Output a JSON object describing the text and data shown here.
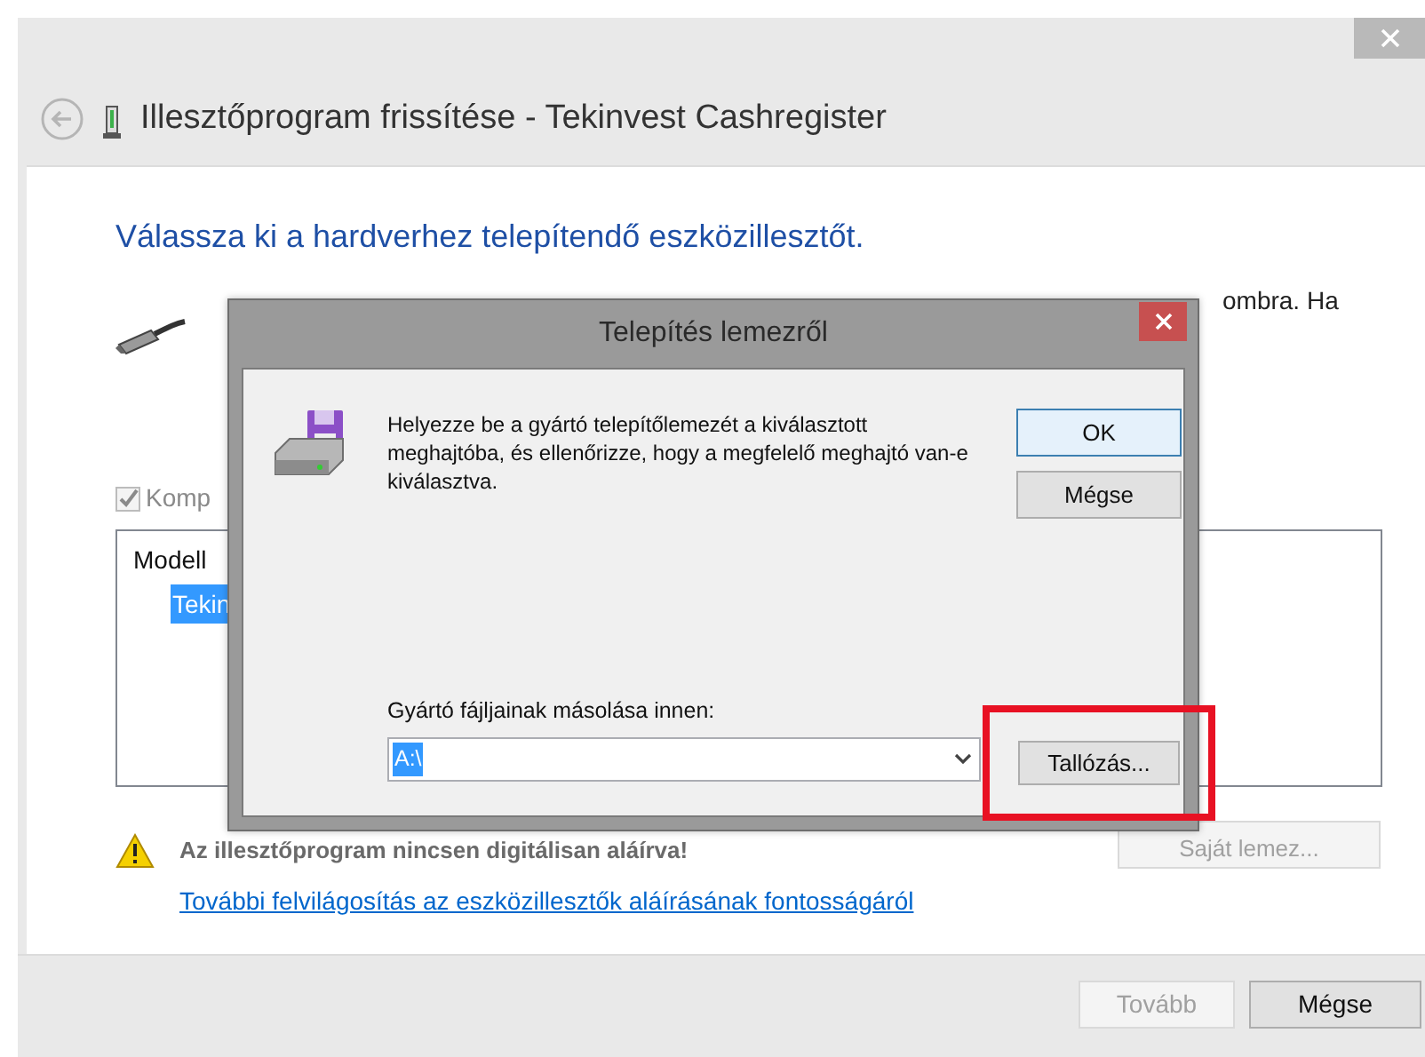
{
  "window": {
    "title": "Illesztőprogram frissítése - Tekinvest Cashregister"
  },
  "heading": "Válassza ki a hardverhez telepítendő eszközillesztőt.",
  "description_fragment": "ombra. Ha",
  "compatible_checkbox": {
    "label": "Komp",
    "checked": true,
    "disabled": true
  },
  "model_list": {
    "column": "Modell",
    "rows": [
      {
        "label": "Tekin",
        "selected": true
      }
    ]
  },
  "warning": "Az illesztőprogram nincsen digitálisan aláírva!",
  "have_disk_button": {
    "label": "Saját lemez...",
    "disabled": true
  },
  "link": "További felvilágosítás az eszközillesztők aláírásának fontosságáról",
  "footer_buttons": [
    {
      "label": "Tovább",
      "disabled": true
    },
    {
      "label": "Mégse",
      "disabled": false
    }
  ],
  "dialog": {
    "title": "Telepítés lemezről",
    "message": "Helyezze be a gyártó telepítőlemezét a kiválasztott meghajtóba, és ellenőrizze, hogy a megfelelő meghajtó van-e kiválasztva.",
    "buttons": [
      {
        "label": "OK",
        "default": true
      },
      {
        "label": "Mégse",
        "default": false
      }
    ],
    "copy_label": "Gyártó fájljainak másolása innen:",
    "copy_from": "A:\\",
    "copy_from_selected": true,
    "browse_button": "Tallózás...",
    "browse_highlighted": true
  }
}
